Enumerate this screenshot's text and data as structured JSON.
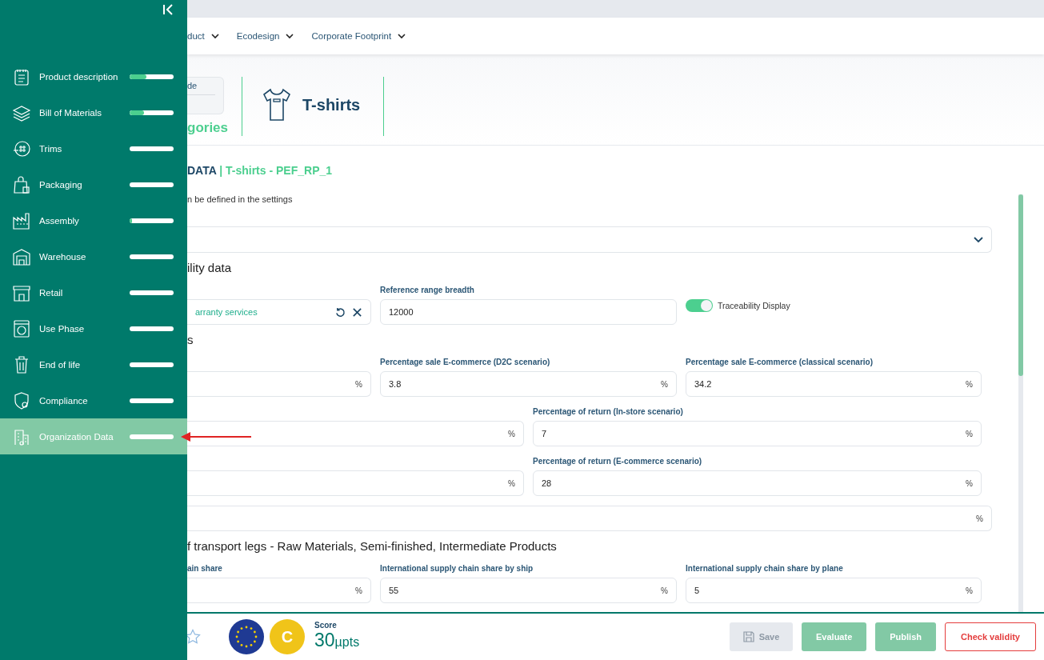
{
  "sidebar": {
    "items": [
      {
        "label": "Product description",
        "level": 0.38,
        "selected": false
      },
      {
        "label": "Bill of Materials",
        "level": 0.32,
        "selected": false
      },
      {
        "label": "Trims",
        "level": 0,
        "selected": false
      },
      {
        "label": "Packaging",
        "level": 0,
        "selected": false
      },
      {
        "label": "Assembly",
        "level": 0.06,
        "selected": false
      },
      {
        "label": "Warehouse",
        "level": 0,
        "selected": false
      },
      {
        "label": "Retail",
        "level": 0,
        "selected": false
      },
      {
        "label": "Use Phase",
        "level": 0,
        "selected": false
      },
      {
        "label": "End of life",
        "level": 0,
        "selected": false
      },
      {
        "label": "Compliance",
        "level": 0,
        "selected": false
      },
      {
        "label": "Organization Data",
        "level": 0,
        "selected": true
      }
    ]
  },
  "nav": {
    "items": [
      {
        "label": "duct"
      },
      {
        "label": "Ecodesign"
      },
      {
        "label": "Corporate Footprint"
      }
    ]
  },
  "header": {
    "card_text": "de",
    "categories": "gories",
    "product": "T-shirts"
  },
  "form": [
    {
      "kind": "title",
      "text": "DATA",
      "subtitle": "| T-shirts - PEF_RP_1"
    },
    {
      "kind": "note",
      "text": "n be defined in the settings"
    },
    {
      "kind": "dropdown"
    },
    {
      "kind": "heading",
      "text": "ility data"
    },
    {
      "kind": "row",
      "cells": [
        {
          "kind": "select",
          "value": "arranty services"
        },
        {
          "kind": "input",
          "label": "Reference range breadth",
          "value": "12000"
        },
        {
          "kind": "toggle",
          "label": "Traceability Display",
          "on": true
        }
      ]
    },
    {
      "kind": "heading",
      "text": "s"
    },
    {
      "kind": "row",
      "cells": [
        {
          "kind": "input",
          "unit": "%"
        },
        {
          "kind": "input",
          "label": "Percentage sale E-commerce (D2C scenario)",
          "value": "3.8",
          "unit": "%"
        },
        {
          "kind": "input",
          "label": "Percentage sale E-commerce (classical scenario)",
          "value": "34.2",
          "unit": "%"
        }
      ]
    },
    {
      "kind": "row",
      "cells": [
        {
          "kind": "input",
          "unit": "%"
        },
        {
          "kind": "input",
          "label": "Percentage of return (In-store scenario)",
          "value": "7",
          "unit": "%"
        }
      ]
    },
    {
      "kind": "row",
      "cells": [
        {
          "kind": "input",
          "unit": "%"
        },
        {
          "kind": "input",
          "label": "Percentage of return (E-commerce scenario)",
          "value": "28",
          "unit": "%"
        }
      ]
    },
    {
      "kind": "row",
      "cells": [
        {
          "kind": "input",
          "unit": "%"
        }
      ]
    },
    {
      "kind": "heading",
      "text": "f transport legs - Raw Materials, Semi-finished, Intermediate Products"
    },
    {
      "kind": "row",
      "cells": [
        {
          "kind": "input",
          "label": "ain share",
          "unit": "%"
        },
        {
          "kind": "input",
          "label": "International supply chain share by ship",
          "value": "55",
          "unit": "%"
        },
        {
          "kind": "input",
          "label": "International supply chain share by plane",
          "value": "5",
          "unit": "%"
        }
      ]
    }
  ],
  "footer": {
    "grade": "C",
    "score_label": "Score",
    "score_value": "30",
    "score_unit": "µpts",
    "buttons": [
      {
        "label": "Save",
        "kind": "save",
        "disabled": true
      },
      {
        "label": "Evaluate",
        "kind": "primary",
        "disabled": false
      },
      {
        "label": "Publish",
        "kind": "primary",
        "disabled": false
      },
      {
        "label": "Check validity",
        "kind": "outline",
        "disabled": false
      }
    ]
  }
}
